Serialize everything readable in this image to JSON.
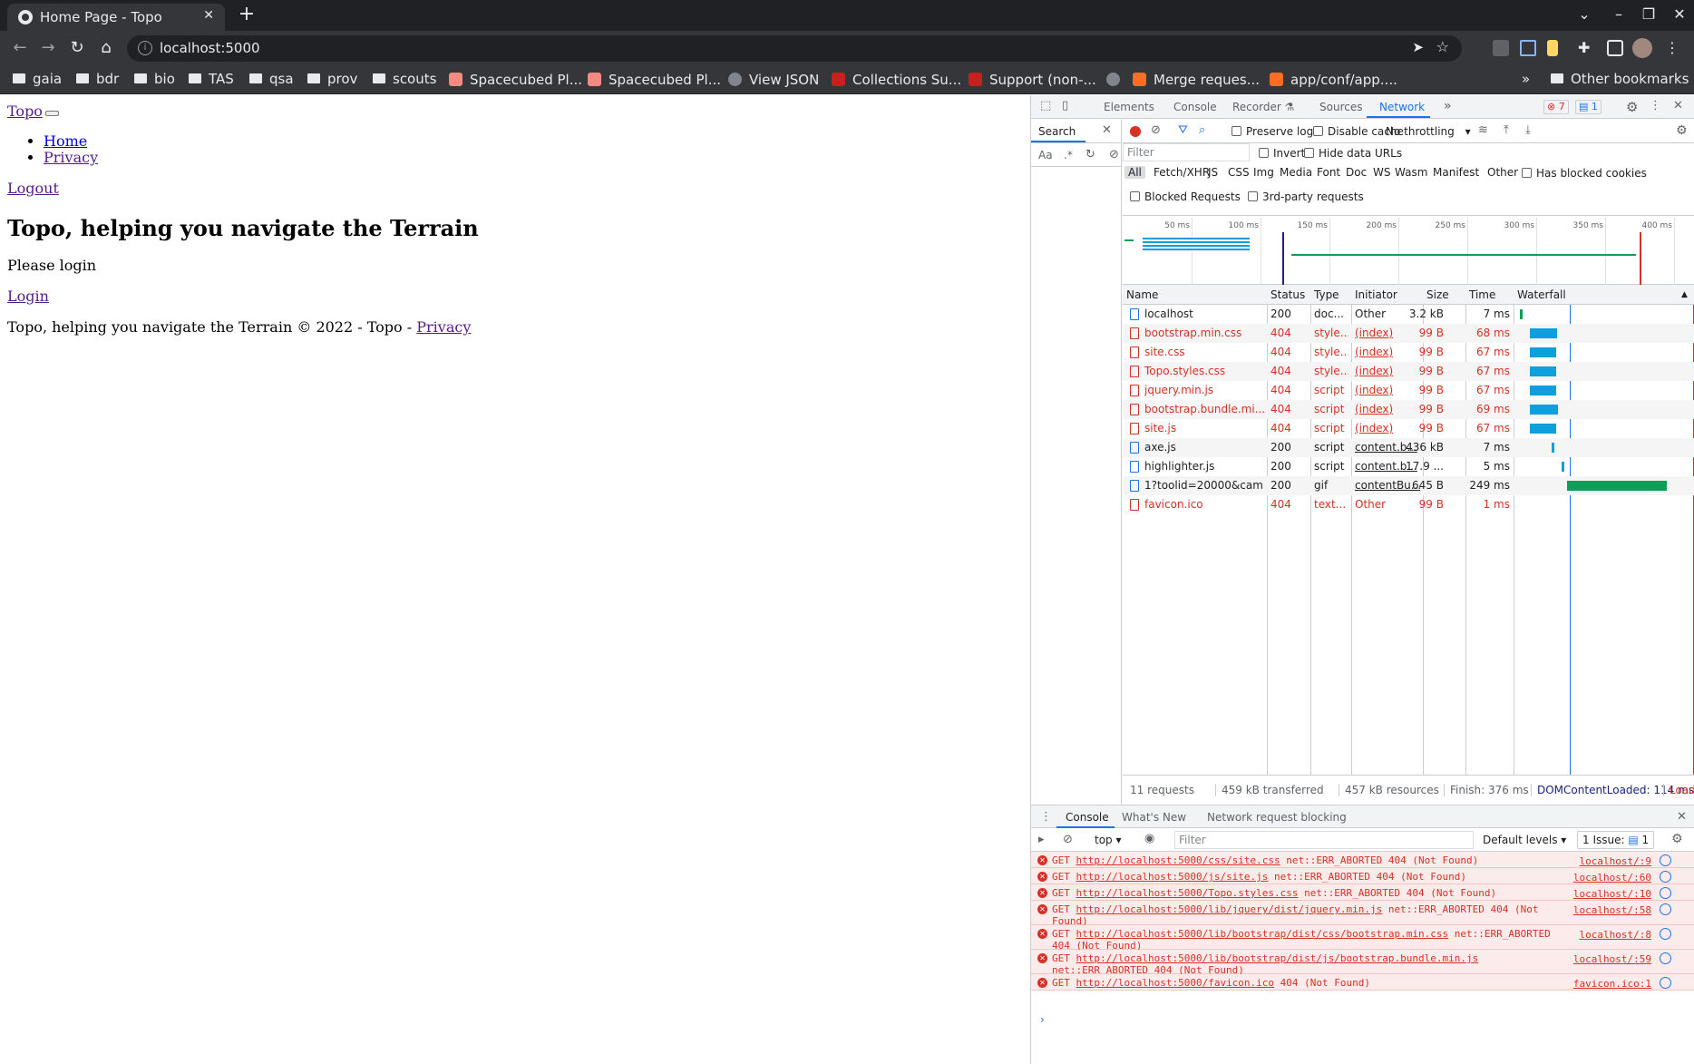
{
  "browser": {
    "tab_title": "Home Page - Topo",
    "url": "localhost:5000",
    "bookmarks": [
      "gaia",
      "bdr",
      "bio",
      "TAS",
      "qsa",
      "prov",
      "scouts",
      "Spacecubed Pl...",
      "Spacecubed Pl...",
      "View JSON",
      "Collections Su...",
      "Support (non-...",
      "Merge reques...",
      "app/conf/app....",
      "Other bookmarks"
    ]
  },
  "page": {
    "brand": "Topo",
    "nav": [
      "Home",
      "Privacy"
    ],
    "logout": "Logout",
    "heading": "Topo, helping you navigate the Terrain",
    "please_login": "Please login",
    "login": "Login",
    "footer_text": "Topo, helping you navigate the Terrain © 2022 - Topo - ",
    "footer_link": "Privacy"
  },
  "devtools": {
    "tabs": [
      "Elements",
      "Console",
      "Recorder",
      "Sources",
      "Network"
    ],
    "active_tab": "Network",
    "error_count": "7",
    "message_count": "1",
    "search_tab": "Search",
    "search_aa": "Aa",
    "search_regex": ".*",
    "toolbar": {
      "preserve_log": "Preserve log",
      "disable_cache": "Disable cache",
      "throttling": "No throttling"
    },
    "filter_placeholder": "Filter",
    "invert": "Invert",
    "hide_data_urls": "Hide data URLs",
    "type_filters": [
      "All",
      "Fetch/XHR",
      "JS",
      "CSS",
      "Img",
      "Media",
      "Font",
      "Doc",
      "WS",
      "Wasm",
      "Manifest",
      "Other"
    ],
    "has_blocked_cookies": "Has blocked cookies",
    "blocked_requests": "Blocked Requests",
    "third_party": "3rd-party requests",
    "timeline_ticks": [
      "50 ms",
      "100 ms",
      "150 ms",
      "200 ms",
      "250 ms",
      "300 ms",
      "350 ms",
      "400 ms"
    ],
    "columns": [
      "Name",
      "Status",
      "Type",
      "Initiator",
      "Size",
      "Time",
      "Waterfall"
    ],
    "requests": [
      {
        "name": "localhost",
        "status": "200",
        "type": "doc...",
        "initiator": "Other",
        "size": "3.2 kB",
        "time": "7 ms",
        "error": false
      },
      {
        "name": "bootstrap.min.css",
        "status": "404",
        "type": "style...",
        "initiator": "(index)",
        "size": "99 B",
        "time": "68 ms",
        "error": true
      },
      {
        "name": "site.css",
        "status": "404",
        "type": "style...",
        "initiator": "(index)",
        "size": "99 B",
        "time": "67 ms",
        "error": true
      },
      {
        "name": "Topo.styles.css",
        "status": "404",
        "type": "style...",
        "initiator": "(index)",
        "size": "99 B",
        "time": "67 ms",
        "error": true
      },
      {
        "name": "jquery.min.js",
        "status": "404",
        "type": "script",
        "initiator": "(index)",
        "size": "99 B",
        "time": "67 ms",
        "error": true
      },
      {
        "name": "bootstrap.bundle.mi...",
        "status": "404",
        "type": "script",
        "initiator": "(index)",
        "size": "99 B",
        "time": "69 ms",
        "error": true
      },
      {
        "name": "site.js",
        "status": "404",
        "type": "script",
        "initiator": "(index)",
        "size": "99 B",
        "time": "67 ms",
        "error": true
      },
      {
        "name": "axe.js",
        "status": "200",
        "type": "script",
        "initiator": "content.b...",
        "size": "436 kB",
        "time": "7 ms",
        "error": false
      },
      {
        "name": "highlighter.js",
        "status": "200",
        "type": "script",
        "initiator": "content.b...",
        "size": "17.9 ...",
        "time": "5 ms",
        "error": false
      },
      {
        "name": "1?toolid=20000&cam...",
        "status": "200",
        "type": "gif",
        "initiator": "contentBu...",
        "size": "645 B",
        "time": "249 ms",
        "error": false
      },
      {
        "name": "favicon.ico",
        "status": "404",
        "type": "text...",
        "initiator": "Other",
        "size": "99 B",
        "time": "1 ms",
        "error": true
      }
    ],
    "summary": {
      "requests": "11 requests",
      "transferred": "459 kB transferred",
      "resources": "457 kB resources",
      "finish": "Finish: 376 ms",
      "dcl": "DOMContentLoaded: 114 ms",
      "load": "Load:"
    },
    "drawer_tabs": [
      "Console",
      "What's New",
      "Network request blocking"
    ],
    "console": {
      "context": "top",
      "filter_placeholder": "Filter",
      "levels": "Default levels",
      "issues": "1 Issue:",
      "issues_count": "1",
      "messages": [
        {
          "method": "GET",
          "url": "http://localhost:5000/css/site.css",
          "rest": " net::ERR_ABORTED 404 (Not Found)",
          "src": "localhost/:9"
        },
        {
          "method": "GET",
          "url": "http://localhost:5000/js/site.js",
          "rest": " net::ERR_ABORTED 404 (Not Found)",
          "src": "localhost/:60"
        },
        {
          "method": "GET",
          "url": "http://localhost:5000/Topo.styles.css",
          "rest": " net::ERR_ABORTED 404 (Not Found)",
          "src": "localhost/:10"
        },
        {
          "method": "GET",
          "url": "http://localhost:5000/lib/jquery/dist/jquery.min.js",
          "rest": " net::ERR_ABORTED 404 (Not Found)",
          "src": "localhost/:58"
        },
        {
          "method": "GET",
          "url": "http://localhost:5000/lib/bootstrap/dist/css/bootstrap.min.css",
          "rest": " net::ERR_ABORTED 404 (Not Found)",
          "src": "localhost/:8"
        },
        {
          "method": "GET",
          "url": "http://localhost:5000/lib/bootstrap/dist/js/bootstrap.bundle.min.js",
          "rest": " net::ERR_ABORTED 404 (Not Found)",
          "src": "localhost/:59"
        },
        {
          "method": "GET",
          "url": "http://localhost:5000/favicon.ico",
          "rest": " 404 (Not Found)",
          "src": "favicon.ico:1"
        }
      ]
    },
    "colors": {
      "accent": "#1a73e8",
      "error": "#d93025",
      "bar_blue": "#0e9fdc",
      "bar_green": "#0f9d58"
    }
  }
}
